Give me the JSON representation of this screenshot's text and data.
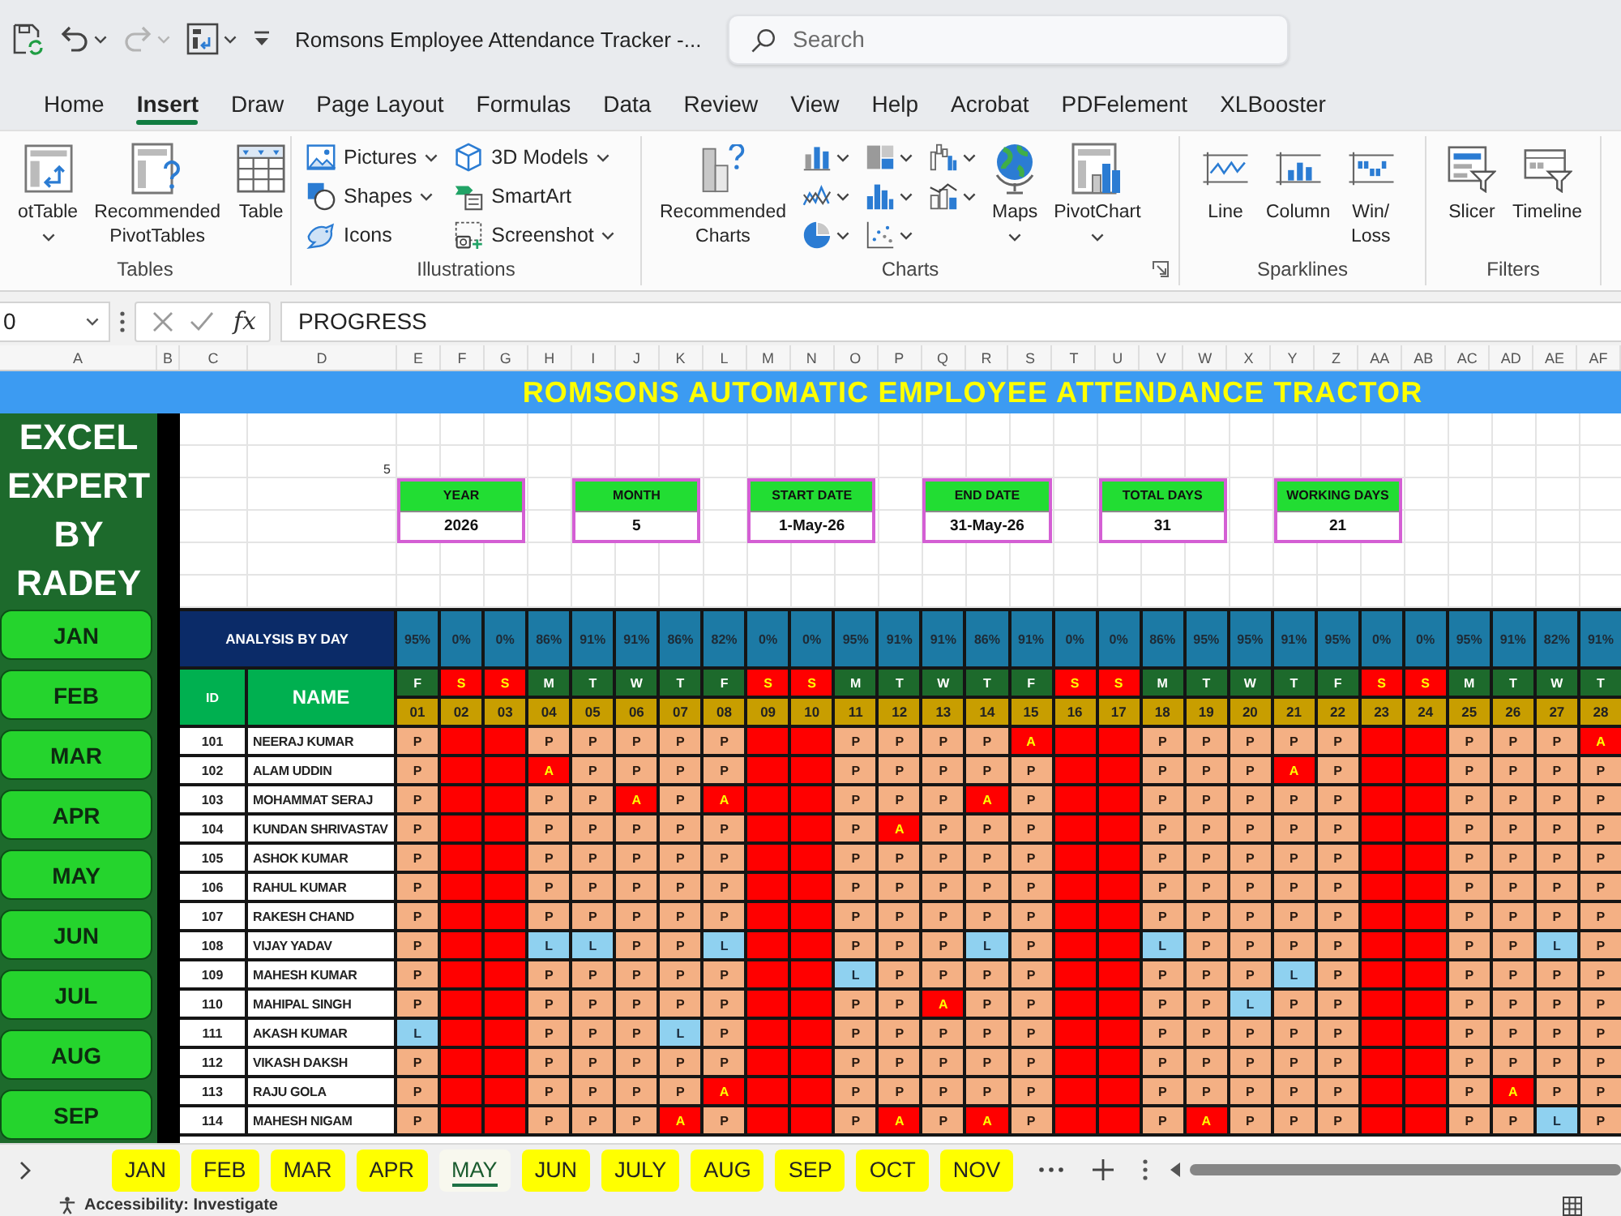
{
  "window": {
    "title": "Romsons Employee Attendance Tracker -...",
    "quick_access": [
      {
        "dropdown": false,
        "disabled": false
      },
      {
        "dropdown": true,
        "disabled": false
      },
      {
        "dropdown": true,
        "disabled": true
      },
      {
        "dropdown": true,
        "disabled": false
      },
      {
        "dropdown": false,
        "disabled": false
      }
    ],
    "search": {
      "placeholder": "Search"
    }
  },
  "ribbon_tabs": [
    {
      "label": "Home",
      "selected": false
    },
    {
      "label": "Insert",
      "selected": true
    },
    {
      "label": "Draw",
      "selected": false
    },
    {
      "label": "Page Layout",
      "selected": false
    },
    {
      "label": "Formulas",
      "selected": false
    },
    {
      "label": "Data",
      "selected": false
    },
    {
      "label": "Review",
      "selected": false
    },
    {
      "label": "View",
      "selected": false
    },
    {
      "label": "Help",
      "selected": false
    },
    {
      "label": "Acrobat",
      "selected": false
    },
    {
      "label": "PDFelement",
      "selected": false
    },
    {
      "label": "XLBooster",
      "selected": false
    }
  ],
  "ribbon": {
    "groups": [
      {
        "label": "Tables",
        "launcher": false,
        "items": [
          {
            "kind": "large",
            "label": "otTable",
            "dropdown": true
          },
          {
            "kind": "large",
            "label": "Recommended\nPivotTables",
            "dropdown": false
          },
          {
            "kind": "large",
            "label": "Table",
            "dropdown": false
          }
        ]
      },
      {
        "label": "Illustrations",
        "launcher": false,
        "items": [
          {
            "kind": "small",
            "label": "Pictures",
            "dropdown": true
          },
          {
            "kind": "small",
            "label": "Shapes",
            "dropdown": true
          },
          {
            "kind": "small",
            "label": "Icons",
            "dropdown": false
          },
          {
            "kind": "small",
            "label": "3D Models",
            "dropdown": true
          },
          {
            "kind": "small",
            "label": "SmartArt",
            "dropdown": false
          },
          {
            "kind": "small",
            "label": "Screenshot",
            "dropdown": true
          }
        ]
      },
      {
        "label": "Charts",
        "launcher": true,
        "items": [
          {
            "kind": "large",
            "label": "Recommended\nCharts",
            "dropdown": false
          },
          {
            "kind": "icon",
            "dropdown": true
          },
          {
            "kind": "icon",
            "dropdown": true
          },
          {
            "kind": "icon",
            "dropdown": true
          },
          {
            "kind": "icon",
            "dropdown": true
          },
          {
            "kind": "icon",
            "dropdown": true
          },
          {
            "kind": "icon",
            "dropdown": true
          },
          {
            "kind": "icon",
            "dropdown": true
          },
          {
            "kind": "icon",
            "dropdown": true
          },
          {
            "kind": "large",
            "label": "Maps",
            "dropdown": true
          },
          {
            "kind": "large",
            "label": "PivotChart",
            "dropdown": true
          }
        ]
      },
      {
        "label": "Sparklines",
        "launcher": false,
        "items": [
          {
            "kind": "large",
            "label": "Line",
            "dropdown": false
          },
          {
            "kind": "large",
            "label": "Column",
            "dropdown": false
          },
          {
            "kind": "large",
            "label": "Win/\nLoss",
            "dropdown": false
          }
        ]
      },
      {
        "label": "Filters",
        "launcher": false,
        "items": [
          {
            "kind": "large",
            "label": "Slicer",
            "dropdown": false
          },
          {
            "kind": "large",
            "label": "Timeline",
            "dropdown": false
          }
        ]
      }
    ]
  },
  "formula_bar": {
    "name_box": "0",
    "function_label": "fx",
    "formula": "PROGRESS"
  },
  "column_headers": [
    "A",
    "B",
    "C",
    "D",
    "E",
    "F",
    "G",
    "H",
    "I",
    "J",
    "K",
    "L",
    "M",
    "N",
    "O",
    "P",
    "Q",
    "R",
    "S",
    "T",
    "U",
    "V",
    "W",
    "X",
    "Y",
    "Z",
    "AA",
    "AB",
    "AC",
    "AD",
    "AE",
    "AF"
  ],
  "sheet": {
    "banner": "ROMSONS AUTOMATIC EMPLOYEE ATTENDANCE TRACTOR",
    "brand": "EXCEL EXPERT BY RADEY",
    "month_buttons": [
      {
        "label": "JAN"
      },
      {
        "label": "FEB"
      },
      {
        "label": "MAR"
      },
      {
        "label": "APR"
      },
      {
        "label": "MAY"
      },
      {
        "label": "JUN"
      },
      {
        "label": "JUL"
      },
      {
        "label": "AUG"
      },
      {
        "label": "SEP"
      }
    ],
    "cell_value": "5",
    "summary": [
      {
        "label": "YEAR",
        "value": "2026"
      },
      {
        "label": "MONTH",
        "value": "5"
      },
      {
        "label": "START DATE",
        "value": "1-May-26"
      },
      {
        "label": "END DATE",
        "value": "31-May-26"
      },
      {
        "label": "TOTAL DAYS",
        "value": "31"
      },
      {
        "label": "WORKING DAYS",
        "value": "21"
      }
    ],
    "analysis_label": "ANALYSIS BY DAY",
    "id_header": "ID",
    "name_header": "NAME",
    "days": [
      {
        "letter": "F",
        "date": "01",
        "share": "95%",
        "weekend": false
      },
      {
        "letter": "S",
        "date": "02",
        "share": "0%",
        "weekend": true
      },
      {
        "letter": "S",
        "date": "03",
        "share": "0%",
        "weekend": true
      },
      {
        "letter": "M",
        "date": "04",
        "share": "86%",
        "weekend": false
      },
      {
        "letter": "T",
        "date": "05",
        "share": "91%",
        "weekend": false
      },
      {
        "letter": "W",
        "date": "06",
        "share": "91%",
        "weekend": false
      },
      {
        "letter": "T",
        "date": "07",
        "share": "86%",
        "weekend": false
      },
      {
        "letter": "F",
        "date": "08",
        "share": "82%",
        "weekend": false
      },
      {
        "letter": "S",
        "date": "09",
        "share": "0%",
        "weekend": true
      },
      {
        "letter": "S",
        "date": "10",
        "share": "0%",
        "weekend": true
      },
      {
        "letter": "M",
        "date": "11",
        "share": "95%",
        "weekend": false
      },
      {
        "letter": "T",
        "date": "12",
        "share": "91%",
        "weekend": false
      },
      {
        "letter": "W",
        "date": "13",
        "share": "91%",
        "weekend": false
      },
      {
        "letter": "T",
        "date": "14",
        "share": "86%",
        "weekend": false
      },
      {
        "letter": "F",
        "date": "15",
        "share": "91%",
        "weekend": false
      },
      {
        "letter": "S",
        "date": "16",
        "share": "0%",
        "weekend": true
      },
      {
        "letter": "S",
        "date": "17",
        "share": "0%",
        "weekend": true
      },
      {
        "letter": "M",
        "date": "18",
        "share": "86%",
        "weekend": false
      },
      {
        "letter": "T",
        "date": "19",
        "share": "95%",
        "weekend": false
      },
      {
        "letter": "W",
        "date": "20",
        "share": "95%",
        "weekend": false
      },
      {
        "letter": "T",
        "date": "21",
        "share": "91%",
        "weekend": false
      },
      {
        "letter": "F",
        "date": "22",
        "share": "95%",
        "weekend": false
      },
      {
        "letter": "S",
        "date": "23",
        "share": "0%",
        "weekend": true
      },
      {
        "letter": "S",
        "date": "24",
        "share": "0%",
        "weekend": true
      },
      {
        "letter": "M",
        "date": "25",
        "share": "95%",
        "weekend": false
      },
      {
        "letter": "T",
        "date": "26",
        "share": "91%",
        "weekend": false
      },
      {
        "letter": "W",
        "date": "27",
        "share": "82%",
        "weekend": false
      },
      {
        "letter": "T",
        "date": "28",
        "share": "91%",
        "weekend": false
      }
    ],
    "employees": [
      {
        "id": "101",
        "name": "NEERAJ KUMAR",
        "marks": [
          {
            "kind": "present",
            "text": "P"
          },
          {
            "kind": "off"
          },
          {
            "kind": "off"
          },
          {
            "kind": "present",
            "text": "P"
          },
          {
            "kind": "present",
            "text": "P"
          },
          {
            "kind": "present",
            "text": "P"
          },
          {
            "kind": "present",
            "text": "P"
          },
          {
            "kind": "present",
            "text": "P"
          },
          {
            "kind": "off"
          },
          {
            "kind": "off"
          },
          {
            "kind": "present",
            "text": "P"
          },
          {
            "kind": "present",
            "text": "P"
          },
          {
            "kind": "present",
            "text": "P"
          },
          {
            "kind": "present",
            "text": "P"
          },
          {
            "kind": "absent",
            "text": "A"
          },
          {
            "kind": "off"
          },
          {
            "kind": "off"
          },
          {
            "kind": "present",
            "text": "P"
          },
          {
            "kind": "present",
            "text": "P"
          },
          {
            "kind": "present",
            "text": "P"
          },
          {
            "kind": "present",
            "text": "P"
          },
          {
            "kind": "present",
            "text": "P"
          },
          {
            "kind": "off"
          },
          {
            "kind": "off"
          },
          {
            "kind": "present",
            "text": "P"
          },
          {
            "kind": "present",
            "text": "P"
          },
          {
            "kind": "present",
            "text": "P"
          },
          {
            "kind": "absent",
            "text": "A"
          }
        ]
      },
      {
        "id": "102",
        "name": "ALAM UDDIN",
        "marks": [
          {
            "kind": "present",
            "text": "P"
          },
          {
            "kind": "off"
          },
          {
            "kind": "off"
          },
          {
            "kind": "absent",
            "text": "A"
          },
          {
            "kind": "present",
            "text": "P"
          },
          {
            "kind": "present",
            "text": "P"
          },
          {
            "kind": "present",
            "text": "P"
          },
          {
            "kind": "present",
            "text": "P"
          },
          {
            "kind": "off"
          },
          {
            "kind": "off"
          },
          {
            "kind": "present",
            "text": "P"
          },
          {
            "kind": "present",
            "text": "P"
          },
          {
            "kind": "present",
            "text": "P"
          },
          {
            "kind": "present",
            "text": "P"
          },
          {
            "kind": "present",
            "text": "P"
          },
          {
            "kind": "off"
          },
          {
            "kind": "off"
          },
          {
            "kind": "present",
            "text": "P"
          },
          {
            "kind": "present",
            "text": "P"
          },
          {
            "kind": "present",
            "text": "P"
          },
          {
            "kind": "absent",
            "text": "A"
          },
          {
            "kind": "present",
            "text": "P"
          },
          {
            "kind": "off"
          },
          {
            "kind": "off"
          },
          {
            "kind": "present",
            "text": "P"
          },
          {
            "kind": "present",
            "text": "P"
          },
          {
            "kind": "present",
            "text": "P"
          },
          {
            "kind": "present",
            "text": "P"
          }
        ]
      },
      {
        "id": "103",
        "name": "MOHAMMAT SERAJ",
        "marks": [
          {
            "kind": "present",
            "text": "P"
          },
          {
            "kind": "off"
          },
          {
            "kind": "off"
          },
          {
            "kind": "present",
            "text": "P"
          },
          {
            "kind": "present",
            "text": "P"
          },
          {
            "kind": "absent",
            "text": "A"
          },
          {
            "kind": "present",
            "text": "P"
          },
          {
            "kind": "absent",
            "text": "A"
          },
          {
            "kind": "off"
          },
          {
            "kind": "off"
          },
          {
            "kind": "present",
            "text": "P"
          },
          {
            "kind": "present",
            "text": "P"
          },
          {
            "kind": "present",
            "text": "P"
          },
          {
            "kind": "absent",
            "text": "A"
          },
          {
            "kind": "present",
            "text": "P"
          },
          {
            "kind": "off"
          },
          {
            "kind": "off"
          },
          {
            "kind": "present",
            "text": "P"
          },
          {
            "kind": "present",
            "text": "P"
          },
          {
            "kind": "present",
            "text": "P"
          },
          {
            "kind": "present",
            "text": "P"
          },
          {
            "kind": "present",
            "text": "P"
          },
          {
            "kind": "off"
          },
          {
            "kind": "off"
          },
          {
            "kind": "present",
            "text": "P"
          },
          {
            "kind": "present",
            "text": "P"
          },
          {
            "kind": "present",
            "text": "P"
          },
          {
            "kind": "present",
            "text": "P"
          }
        ]
      },
      {
        "id": "104",
        "name": "KUNDAN SHRIVASTAV",
        "marks": [
          {
            "kind": "present",
            "text": "P"
          },
          {
            "kind": "off"
          },
          {
            "kind": "off"
          },
          {
            "kind": "present",
            "text": "P"
          },
          {
            "kind": "present",
            "text": "P"
          },
          {
            "kind": "present",
            "text": "P"
          },
          {
            "kind": "present",
            "text": "P"
          },
          {
            "kind": "present",
            "text": "P"
          },
          {
            "kind": "off"
          },
          {
            "kind": "off"
          },
          {
            "kind": "present",
            "text": "P"
          },
          {
            "kind": "absent",
            "text": "A"
          },
          {
            "kind": "present",
            "text": "P"
          },
          {
            "kind": "present",
            "text": "P"
          },
          {
            "kind": "present",
            "text": "P"
          },
          {
            "kind": "off"
          },
          {
            "kind": "off"
          },
          {
            "kind": "present",
            "text": "P"
          },
          {
            "kind": "present",
            "text": "P"
          },
          {
            "kind": "present",
            "text": "P"
          },
          {
            "kind": "present",
            "text": "P"
          },
          {
            "kind": "present",
            "text": "P"
          },
          {
            "kind": "off"
          },
          {
            "kind": "off"
          },
          {
            "kind": "present",
            "text": "P"
          },
          {
            "kind": "present",
            "text": "P"
          },
          {
            "kind": "present",
            "text": "P"
          },
          {
            "kind": "present",
            "text": "P"
          }
        ]
      },
      {
        "id": "105",
        "name": "ASHOK KUMAR",
        "marks": [
          {
            "kind": "present",
            "text": "P"
          },
          {
            "kind": "off"
          },
          {
            "kind": "off"
          },
          {
            "kind": "present",
            "text": "P"
          },
          {
            "kind": "present",
            "text": "P"
          },
          {
            "kind": "present",
            "text": "P"
          },
          {
            "kind": "present",
            "text": "P"
          },
          {
            "kind": "present",
            "text": "P"
          },
          {
            "kind": "off"
          },
          {
            "kind": "off"
          },
          {
            "kind": "present",
            "text": "P"
          },
          {
            "kind": "present",
            "text": "P"
          },
          {
            "kind": "present",
            "text": "P"
          },
          {
            "kind": "present",
            "text": "P"
          },
          {
            "kind": "present",
            "text": "P"
          },
          {
            "kind": "off"
          },
          {
            "kind": "off"
          },
          {
            "kind": "present",
            "text": "P"
          },
          {
            "kind": "present",
            "text": "P"
          },
          {
            "kind": "present",
            "text": "P"
          },
          {
            "kind": "present",
            "text": "P"
          },
          {
            "kind": "present",
            "text": "P"
          },
          {
            "kind": "off"
          },
          {
            "kind": "off"
          },
          {
            "kind": "present",
            "text": "P"
          },
          {
            "kind": "present",
            "text": "P"
          },
          {
            "kind": "present",
            "text": "P"
          },
          {
            "kind": "present",
            "text": "P"
          }
        ]
      },
      {
        "id": "106",
        "name": "RAHUL KUMAR",
        "marks": [
          {
            "kind": "present",
            "text": "P"
          },
          {
            "kind": "off"
          },
          {
            "kind": "off"
          },
          {
            "kind": "present",
            "text": "P"
          },
          {
            "kind": "present",
            "text": "P"
          },
          {
            "kind": "present",
            "text": "P"
          },
          {
            "kind": "present",
            "text": "P"
          },
          {
            "kind": "present",
            "text": "P"
          },
          {
            "kind": "off"
          },
          {
            "kind": "off"
          },
          {
            "kind": "present",
            "text": "P"
          },
          {
            "kind": "present",
            "text": "P"
          },
          {
            "kind": "present",
            "text": "P"
          },
          {
            "kind": "present",
            "text": "P"
          },
          {
            "kind": "present",
            "text": "P"
          },
          {
            "kind": "off"
          },
          {
            "kind": "off"
          },
          {
            "kind": "present",
            "text": "P"
          },
          {
            "kind": "present",
            "text": "P"
          },
          {
            "kind": "present",
            "text": "P"
          },
          {
            "kind": "present",
            "text": "P"
          },
          {
            "kind": "present",
            "text": "P"
          },
          {
            "kind": "off"
          },
          {
            "kind": "off"
          },
          {
            "kind": "present",
            "text": "P"
          },
          {
            "kind": "present",
            "text": "P"
          },
          {
            "kind": "present",
            "text": "P"
          },
          {
            "kind": "present",
            "text": "P"
          }
        ]
      },
      {
        "id": "107",
        "name": "RAKESH CHAND",
        "marks": [
          {
            "kind": "present",
            "text": "P"
          },
          {
            "kind": "off"
          },
          {
            "kind": "off"
          },
          {
            "kind": "present",
            "text": "P"
          },
          {
            "kind": "present",
            "text": "P"
          },
          {
            "kind": "present",
            "text": "P"
          },
          {
            "kind": "present",
            "text": "P"
          },
          {
            "kind": "present",
            "text": "P"
          },
          {
            "kind": "off"
          },
          {
            "kind": "off"
          },
          {
            "kind": "present",
            "text": "P"
          },
          {
            "kind": "present",
            "text": "P"
          },
          {
            "kind": "present",
            "text": "P"
          },
          {
            "kind": "present",
            "text": "P"
          },
          {
            "kind": "present",
            "text": "P"
          },
          {
            "kind": "off"
          },
          {
            "kind": "off"
          },
          {
            "kind": "present",
            "text": "P"
          },
          {
            "kind": "present",
            "text": "P"
          },
          {
            "kind": "present",
            "text": "P"
          },
          {
            "kind": "present",
            "text": "P"
          },
          {
            "kind": "present",
            "text": "P"
          },
          {
            "kind": "off"
          },
          {
            "kind": "off"
          },
          {
            "kind": "present",
            "text": "P"
          },
          {
            "kind": "present",
            "text": "P"
          },
          {
            "kind": "present",
            "text": "P"
          },
          {
            "kind": "present",
            "text": "P"
          }
        ]
      },
      {
        "id": "108",
        "name": "VIJAY YADAV",
        "marks": [
          {
            "kind": "present",
            "text": "P"
          },
          {
            "kind": "off"
          },
          {
            "kind": "off"
          },
          {
            "kind": "leave",
            "text": "L"
          },
          {
            "kind": "leave",
            "text": "L"
          },
          {
            "kind": "present",
            "text": "P"
          },
          {
            "kind": "present",
            "text": "P"
          },
          {
            "kind": "leave",
            "text": "L"
          },
          {
            "kind": "off"
          },
          {
            "kind": "off"
          },
          {
            "kind": "present",
            "text": "P"
          },
          {
            "kind": "present",
            "text": "P"
          },
          {
            "kind": "present",
            "text": "P"
          },
          {
            "kind": "leave",
            "text": "L"
          },
          {
            "kind": "present",
            "text": "P"
          },
          {
            "kind": "off"
          },
          {
            "kind": "off"
          },
          {
            "kind": "leave",
            "text": "L"
          },
          {
            "kind": "present",
            "text": "P"
          },
          {
            "kind": "present",
            "text": "P"
          },
          {
            "kind": "present",
            "text": "P"
          },
          {
            "kind": "present",
            "text": "P"
          },
          {
            "kind": "off"
          },
          {
            "kind": "off"
          },
          {
            "kind": "present",
            "text": "P"
          },
          {
            "kind": "present",
            "text": "P"
          },
          {
            "kind": "leave",
            "text": "L"
          },
          {
            "kind": "present",
            "text": "P"
          }
        ]
      },
      {
        "id": "109",
        "name": "MAHESH KUMAR",
        "marks": [
          {
            "kind": "present",
            "text": "P"
          },
          {
            "kind": "off"
          },
          {
            "kind": "off"
          },
          {
            "kind": "present",
            "text": "P"
          },
          {
            "kind": "present",
            "text": "P"
          },
          {
            "kind": "present",
            "text": "P"
          },
          {
            "kind": "present",
            "text": "P"
          },
          {
            "kind": "present",
            "text": "P"
          },
          {
            "kind": "off"
          },
          {
            "kind": "off"
          },
          {
            "kind": "leave",
            "text": "L"
          },
          {
            "kind": "present",
            "text": "P"
          },
          {
            "kind": "present",
            "text": "P"
          },
          {
            "kind": "present",
            "text": "P"
          },
          {
            "kind": "present",
            "text": "P"
          },
          {
            "kind": "off"
          },
          {
            "kind": "off"
          },
          {
            "kind": "present",
            "text": "P"
          },
          {
            "kind": "present",
            "text": "P"
          },
          {
            "kind": "present",
            "text": "P"
          },
          {
            "kind": "leave",
            "text": "L"
          },
          {
            "kind": "present",
            "text": "P"
          },
          {
            "kind": "off"
          },
          {
            "kind": "off"
          },
          {
            "kind": "present",
            "text": "P"
          },
          {
            "kind": "present",
            "text": "P"
          },
          {
            "kind": "present",
            "text": "P"
          },
          {
            "kind": "present",
            "text": "P"
          }
        ]
      },
      {
        "id": "110",
        "name": "MAHIPAL SINGH",
        "marks": [
          {
            "kind": "present",
            "text": "P"
          },
          {
            "kind": "off"
          },
          {
            "kind": "off"
          },
          {
            "kind": "present",
            "text": "P"
          },
          {
            "kind": "present",
            "text": "P"
          },
          {
            "kind": "present",
            "text": "P"
          },
          {
            "kind": "present",
            "text": "P"
          },
          {
            "kind": "present",
            "text": "P"
          },
          {
            "kind": "off"
          },
          {
            "kind": "off"
          },
          {
            "kind": "present",
            "text": "P"
          },
          {
            "kind": "present",
            "text": "P"
          },
          {
            "kind": "absent",
            "text": "A"
          },
          {
            "kind": "present",
            "text": "P"
          },
          {
            "kind": "present",
            "text": "P"
          },
          {
            "kind": "off"
          },
          {
            "kind": "off"
          },
          {
            "kind": "present",
            "text": "P"
          },
          {
            "kind": "present",
            "text": "P"
          },
          {
            "kind": "leave",
            "text": "L"
          },
          {
            "kind": "present",
            "text": "P"
          },
          {
            "kind": "present",
            "text": "P"
          },
          {
            "kind": "off"
          },
          {
            "kind": "off"
          },
          {
            "kind": "present",
            "text": "P"
          },
          {
            "kind": "present",
            "text": "P"
          },
          {
            "kind": "present",
            "text": "P"
          },
          {
            "kind": "present",
            "text": "P"
          }
        ]
      },
      {
        "id": "111",
        "name": "AKASH KUMAR",
        "marks": [
          {
            "kind": "leave",
            "text": "L"
          },
          {
            "kind": "off"
          },
          {
            "kind": "off"
          },
          {
            "kind": "present",
            "text": "P"
          },
          {
            "kind": "present",
            "text": "P"
          },
          {
            "kind": "present",
            "text": "P"
          },
          {
            "kind": "leave",
            "text": "L"
          },
          {
            "kind": "present",
            "text": "P"
          },
          {
            "kind": "off"
          },
          {
            "kind": "off"
          },
          {
            "kind": "present",
            "text": "P"
          },
          {
            "kind": "present",
            "text": "P"
          },
          {
            "kind": "present",
            "text": "P"
          },
          {
            "kind": "present",
            "text": "P"
          },
          {
            "kind": "present",
            "text": "P"
          },
          {
            "kind": "off"
          },
          {
            "kind": "off"
          },
          {
            "kind": "present",
            "text": "P"
          },
          {
            "kind": "present",
            "text": "P"
          },
          {
            "kind": "present",
            "text": "P"
          },
          {
            "kind": "present",
            "text": "P"
          },
          {
            "kind": "present",
            "text": "P"
          },
          {
            "kind": "off"
          },
          {
            "kind": "off"
          },
          {
            "kind": "present",
            "text": "P"
          },
          {
            "kind": "present",
            "text": "P"
          },
          {
            "kind": "present",
            "text": "P"
          },
          {
            "kind": "present",
            "text": "P"
          }
        ]
      },
      {
        "id": "112",
        "name": "VIKASH DAKSH",
        "marks": [
          {
            "kind": "present",
            "text": "P"
          },
          {
            "kind": "off"
          },
          {
            "kind": "off"
          },
          {
            "kind": "present",
            "text": "P"
          },
          {
            "kind": "present",
            "text": "P"
          },
          {
            "kind": "present",
            "text": "P"
          },
          {
            "kind": "present",
            "text": "P"
          },
          {
            "kind": "present",
            "text": "P"
          },
          {
            "kind": "off"
          },
          {
            "kind": "off"
          },
          {
            "kind": "present",
            "text": "P"
          },
          {
            "kind": "present",
            "text": "P"
          },
          {
            "kind": "present",
            "text": "P"
          },
          {
            "kind": "present",
            "text": "P"
          },
          {
            "kind": "present",
            "text": "P"
          },
          {
            "kind": "off"
          },
          {
            "kind": "off"
          },
          {
            "kind": "present",
            "text": "P"
          },
          {
            "kind": "present",
            "text": "P"
          },
          {
            "kind": "present",
            "text": "P"
          },
          {
            "kind": "present",
            "text": "P"
          },
          {
            "kind": "present",
            "text": "P"
          },
          {
            "kind": "off"
          },
          {
            "kind": "off"
          },
          {
            "kind": "present",
            "text": "P"
          },
          {
            "kind": "present",
            "text": "P"
          },
          {
            "kind": "present",
            "text": "P"
          },
          {
            "kind": "present",
            "text": "P"
          }
        ]
      },
      {
        "id": "113",
        "name": "RAJU GOLA",
        "marks": [
          {
            "kind": "present",
            "text": "P"
          },
          {
            "kind": "off"
          },
          {
            "kind": "off"
          },
          {
            "kind": "present",
            "text": "P"
          },
          {
            "kind": "present",
            "text": "P"
          },
          {
            "kind": "present",
            "text": "P"
          },
          {
            "kind": "present",
            "text": "P"
          },
          {
            "kind": "absent",
            "text": "A"
          },
          {
            "kind": "off"
          },
          {
            "kind": "off"
          },
          {
            "kind": "present",
            "text": "P"
          },
          {
            "kind": "present",
            "text": "P"
          },
          {
            "kind": "present",
            "text": "P"
          },
          {
            "kind": "present",
            "text": "P"
          },
          {
            "kind": "present",
            "text": "P"
          },
          {
            "kind": "off"
          },
          {
            "kind": "off"
          },
          {
            "kind": "present",
            "text": "P"
          },
          {
            "kind": "present",
            "text": "P"
          },
          {
            "kind": "present",
            "text": "P"
          },
          {
            "kind": "present",
            "text": "P"
          },
          {
            "kind": "present",
            "text": "P"
          },
          {
            "kind": "off"
          },
          {
            "kind": "off"
          },
          {
            "kind": "present",
            "text": "P"
          },
          {
            "kind": "absent",
            "text": "A"
          },
          {
            "kind": "present",
            "text": "P"
          },
          {
            "kind": "present",
            "text": "P"
          }
        ]
      },
      {
        "id": "114",
        "name": "MAHESH NIGAM",
        "marks": [
          {
            "kind": "present",
            "text": "P"
          },
          {
            "kind": "off"
          },
          {
            "kind": "off"
          },
          {
            "kind": "present",
            "text": "P"
          },
          {
            "kind": "present",
            "text": "P"
          },
          {
            "kind": "present",
            "text": "P"
          },
          {
            "kind": "absent",
            "text": "A"
          },
          {
            "kind": "present",
            "text": "P"
          },
          {
            "kind": "off"
          },
          {
            "kind": "off"
          },
          {
            "kind": "present",
            "text": "P"
          },
          {
            "kind": "absent",
            "text": "A"
          },
          {
            "kind": "present",
            "text": "P"
          },
          {
            "kind": "absent",
            "text": "A"
          },
          {
            "kind": "present",
            "text": "P"
          },
          {
            "kind": "off"
          },
          {
            "kind": "off"
          },
          {
            "kind": "present",
            "text": "P"
          },
          {
            "kind": "absent",
            "text": "A"
          },
          {
            "kind": "present",
            "text": "P"
          },
          {
            "kind": "present",
            "text": "P"
          },
          {
            "kind": "present",
            "text": "P"
          },
          {
            "kind": "off"
          },
          {
            "kind": "off"
          },
          {
            "kind": "present",
            "text": "P"
          },
          {
            "kind": "present",
            "text": "P"
          },
          {
            "kind": "leave",
            "text": "L"
          },
          {
            "kind": "present",
            "text": "P"
          }
        ]
      }
    ]
  },
  "sheet_tabs": [
    {
      "label": "JAN",
      "selected": false
    },
    {
      "label": "FEB",
      "selected": false
    },
    {
      "label": "MAR",
      "selected": false
    },
    {
      "label": "APR",
      "selected": false
    },
    {
      "label": "MAY",
      "selected": true
    },
    {
      "label": "JUN",
      "selected": false
    },
    {
      "label": "JULY",
      "selected": false
    },
    {
      "label": "AUG",
      "selected": false
    },
    {
      "label": "SEP",
      "selected": false
    },
    {
      "label": "OCT",
      "selected": false
    },
    {
      "label": "NOV",
      "selected": false
    }
  ],
  "status_bar": {
    "accessibility": "Accessibility: Investigate"
  }
}
